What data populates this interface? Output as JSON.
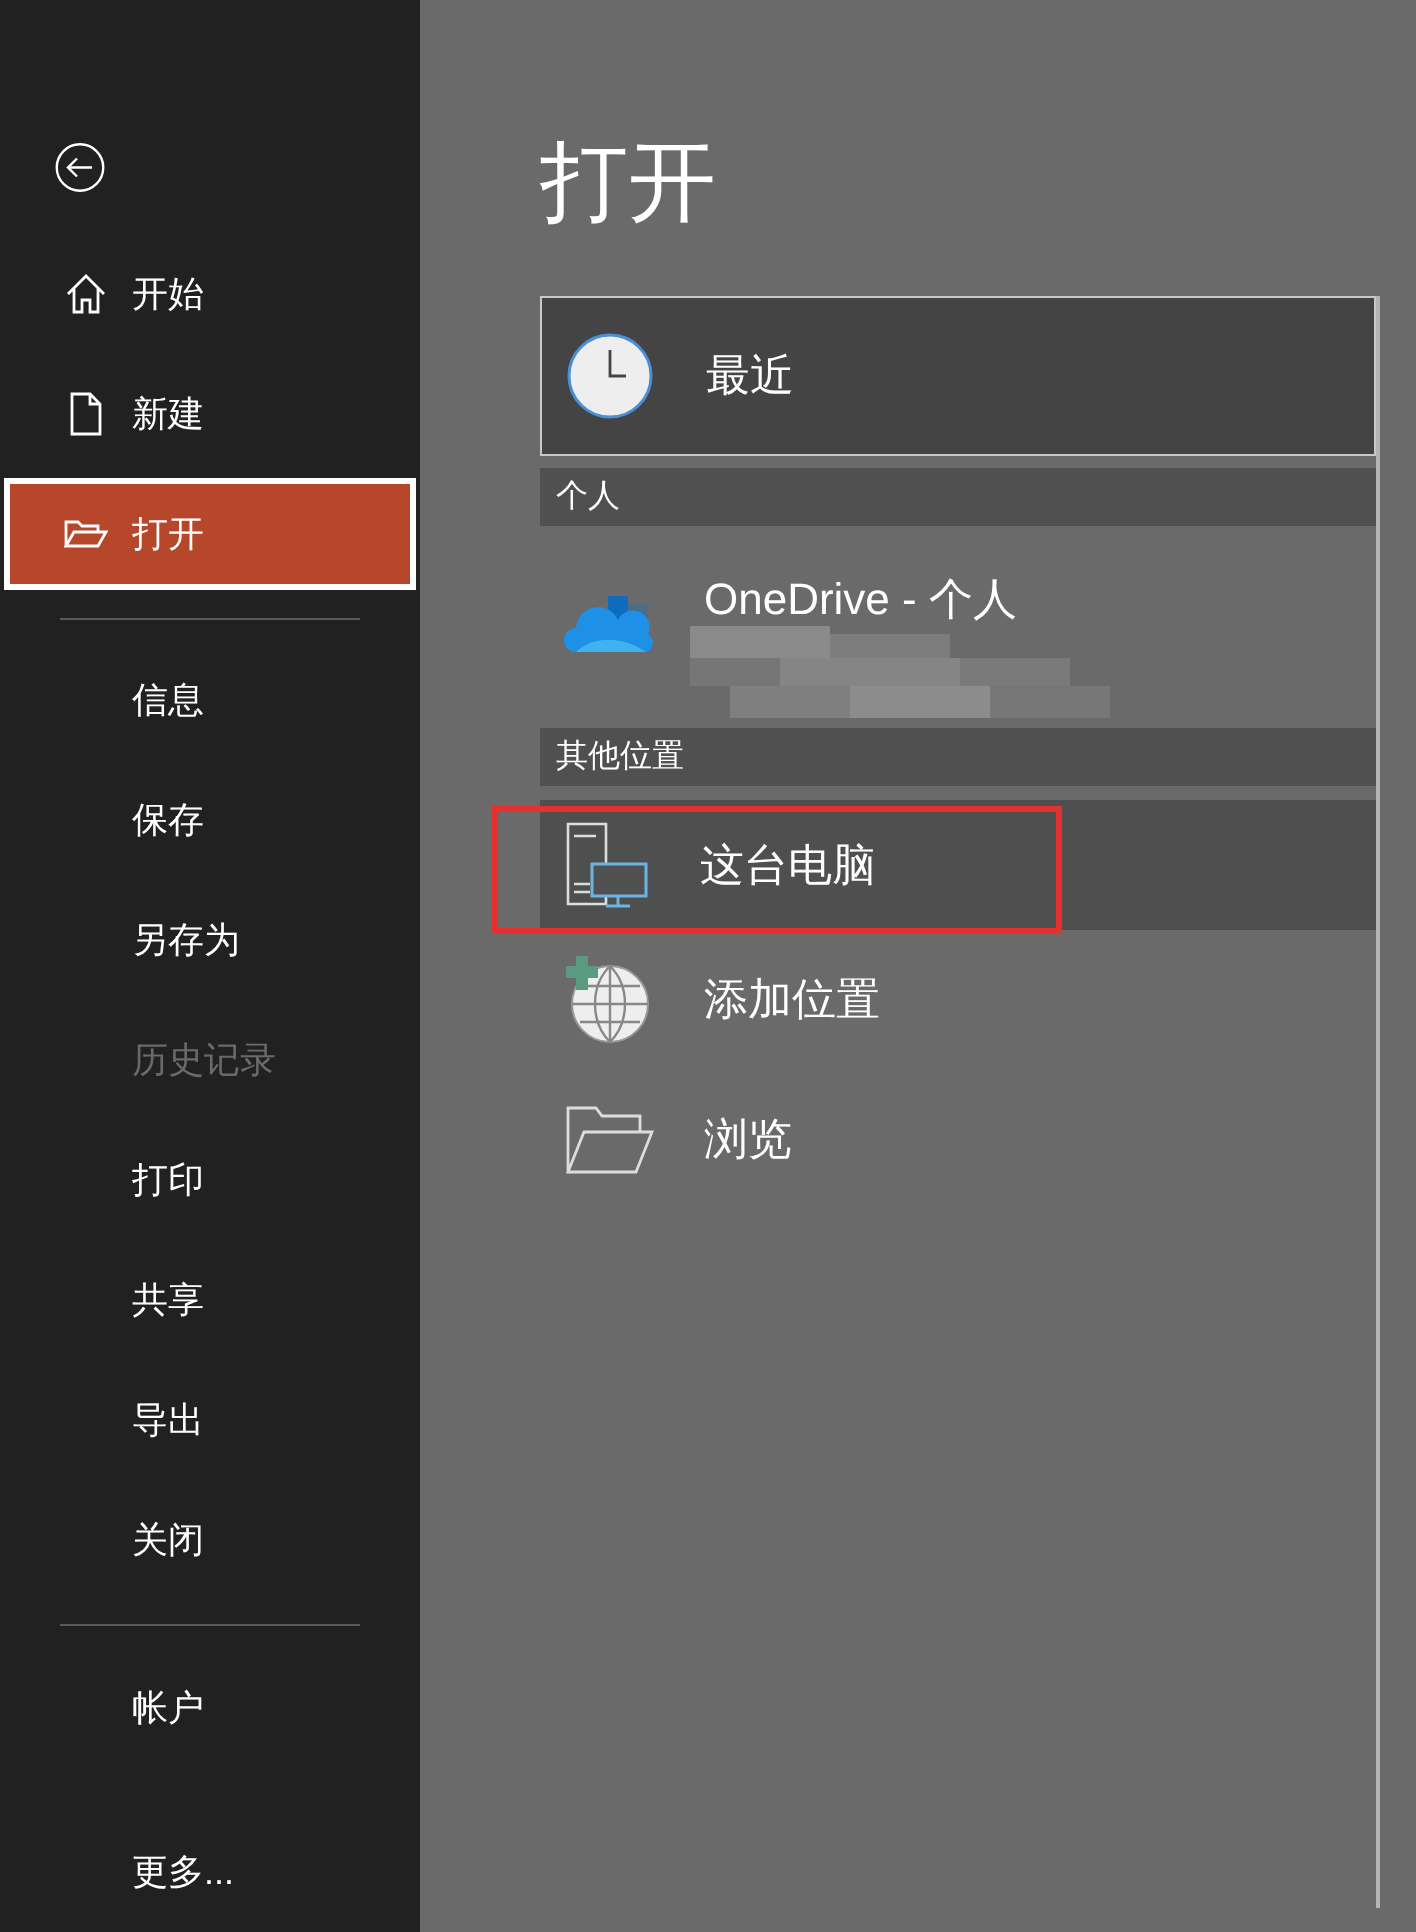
{
  "sidebar": {
    "groups": [
      [
        {
          "label": "开始",
          "kind": "home",
          "selected": false,
          "disabled": false
        },
        {
          "label": "新建",
          "kind": "new",
          "selected": false,
          "disabled": false
        },
        {
          "label": "打开",
          "kind": "open",
          "selected": true,
          "disabled": false
        }
      ],
      [
        {
          "label": "信息",
          "kind": "plain",
          "selected": false,
          "disabled": false
        },
        {
          "label": "保存",
          "kind": "plain",
          "selected": false,
          "disabled": false
        },
        {
          "label": "另存为",
          "kind": "plain",
          "selected": false,
          "disabled": false
        },
        {
          "label": "历史记录",
          "kind": "plain",
          "selected": false,
          "disabled": true
        },
        {
          "label": "打印",
          "kind": "plain",
          "selected": false,
          "disabled": false
        },
        {
          "label": "共享",
          "kind": "plain",
          "selected": false,
          "disabled": false
        },
        {
          "label": "导出",
          "kind": "plain",
          "selected": false,
          "disabled": false
        },
        {
          "label": "关闭",
          "kind": "plain",
          "selected": false,
          "disabled": false
        }
      ],
      [
        {
          "label": "帐户",
          "kind": "plain",
          "selected": false,
          "disabled": false
        },
        {
          "label": "更多...",
          "kind": "plain",
          "selected": false,
          "disabled": false
        }
      ]
    ]
  },
  "title": "打开",
  "locations": [
    {
      "kind": "recent",
      "label": "最近",
      "selected": true,
      "hovered": false,
      "highlighted": false
    },
    {
      "kind": "header",
      "label": "个人"
    },
    {
      "kind": "onedrive",
      "label": "OneDrive - 个人",
      "selected": false,
      "hovered": false,
      "highlighted": false,
      "redacted": true
    },
    {
      "kind": "header",
      "label": "其他位置"
    },
    {
      "kind": "computer",
      "label": "这台电脑",
      "selected": false,
      "hovered": true,
      "highlighted": true
    },
    {
      "kind": "add",
      "label": "添加位置",
      "selected": false,
      "hovered": false,
      "highlighted": false
    },
    {
      "kind": "browse",
      "label": "浏览",
      "selected": false,
      "hovered": false,
      "highlighted": false
    }
  ]
}
